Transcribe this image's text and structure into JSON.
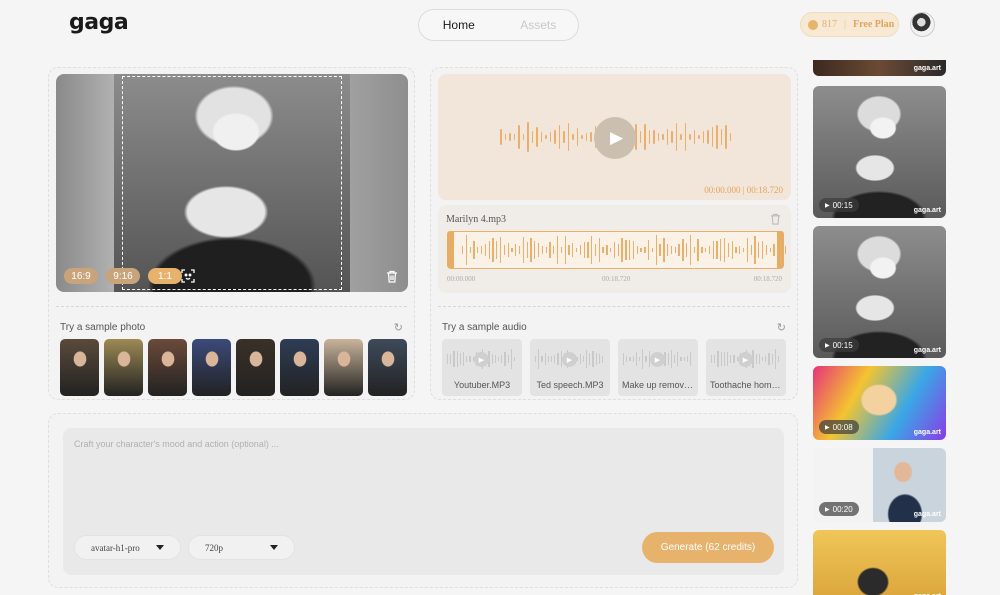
{
  "brand": {
    "logo": "gaga"
  },
  "nav": {
    "tabs": [
      "Home",
      "Assets"
    ]
  },
  "account": {
    "credits": "817",
    "plan": "Free Plan"
  },
  "photo": {
    "ratios": [
      "16:9",
      "9:16",
      "1:1"
    ],
    "active_ratio": "1:1",
    "sample_label": "Try a sample photo",
    "sample_colors": [
      "#5b4a3c",
      "#9d8a55",
      "#6b4a3a",
      "#3b4a7a",
      "#3a3028",
      "#2e3d55",
      "#c9b49a",
      "#3e4a5a"
    ]
  },
  "audio": {
    "time_display": "00:00.000 | 00:18.720",
    "file_name": "Marilyn 4.mp3",
    "ticks": [
      "00:00.000",
      "00:18.720",
      "00:18.720"
    ],
    "sample_label": "Try a sample audio",
    "samples": [
      "Youtuber.MP3",
      "Ted speech.MP3",
      "Make up remover ...",
      "Toothache home r..."
    ]
  },
  "prompt": {
    "placeholder": "Craft your character's mood and action (optional) ...",
    "model": "avatar-h1-pro",
    "resolution": "720p",
    "generate_label": "Generate (62 credits)"
  },
  "sidebar": {
    "watermark": "gaga.art",
    "videos": [
      {
        "duration": ""
      },
      {
        "duration": "00:15"
      },
      {
        "duration": "00:15"
      },
      {
        "duration": "00:08"
      },
      {
        "duration": "00:20"
      },
      {
        "duration": ""
      }
    ]
  },
  "colors": {
    "accent": "#e7b36c",
    "background": "#f5f5f5"
  }
}
